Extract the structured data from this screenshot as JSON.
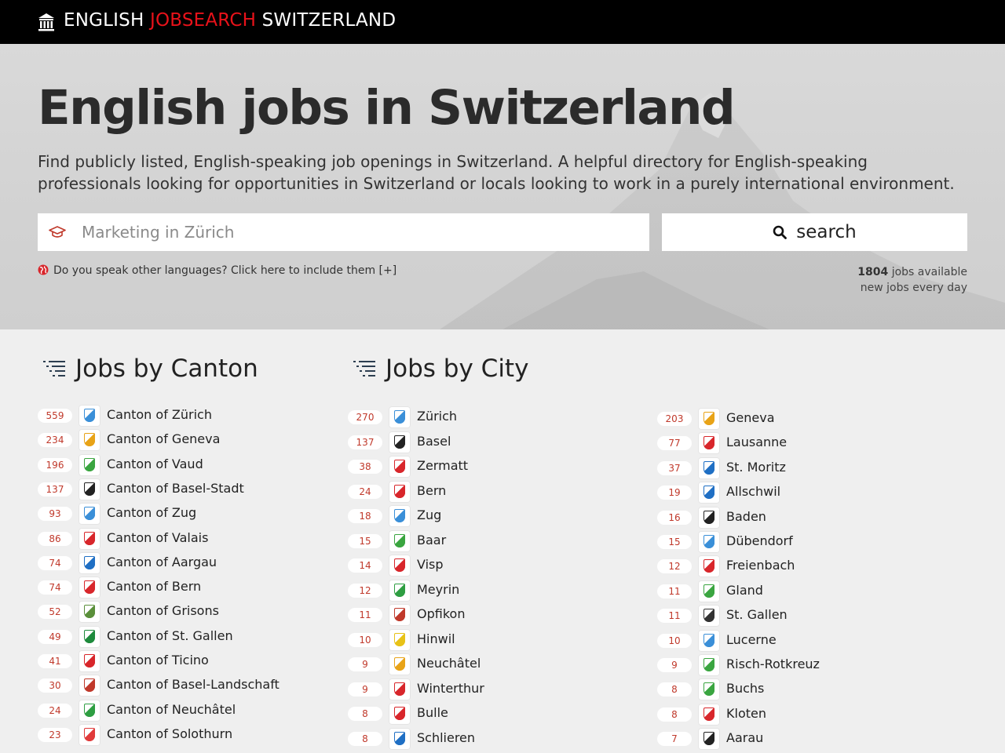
{
  "header": {
    "brand_part1": "ENGLISH",
    "brand_part2": "JOBSEARCH",
    "brand_part3": "SWITZERLAND",
    "logo_icon": "building-icon",
    "accent_color": "#e8121a"
  },
  "hero": {
    "title": "English jobs in Switzerland",
    "lead": "Find publicly listed, English-speaking job openings in Switzerland. A helpful directory for English-speaking professionals looking for opportunities in Switzerland or locals looking to work in a purely international environment.",
    "search_placeholder": "Marketing in Zürich",
    "search_icon": "graduation-cap-icon",
    "search_button": "search",
    "languages_link": "Do you speak other languages? Click here to include them [+]",
    "jobs_count": "1804",
    "jobs_available": "jobs available",
    "new_jobs": "new jobs every day"
  },
  "cantons": {
    "title": "Jobs by Canton",
    "items": [
      {
        "count": "559",
        "name": "Canton of Zürich",
        "color": "#3a8fd8"
      },
      {
        "count": "234",
        "name": "Canton of Geneva",
        "color": "#e8a317"
      },
      {
        "count": "196",
        "name": "Canton of Vaud",
        "color": "#3aa540"
      },
      {
        "count": "137",
        "name": "Canton of Basel-Stadt",
        "color": "#222222"
      },
      {
        "count": "93",
        "name": "Canton of Zug",
        "color": "#3a8fd8"
      },
      {
        "count": "86",
        "name": "Canton of Valais",
        "color": "#d8262b"
      },
      {
        "count": "74",
        "name": "Canton of Aargau",
        "color": "#1f6fc4"
      },
      {
        "count": "74",
        "name": "Canton of Bern",
        "color": "#d8262b"
      },
      {
        "count": "52",
        "name": "Canton of Grisons",
        "color": "#5a8f3a"
      },
      {
        "count": "49",
        "name": "Canton of St. Gallen",
        "color": "#1e8a3c"
      },
      {
        "count": "41",
        "name": "Canton of Ticino",
        "color": "#d8262b"
      },
      {
        "count": "30",
        "name": "Canton of Basel-Landschaft",
        "color": "#c0392b"
      },
      {
        "count": "24",
        "name": "Canton of Neuchâtel",
        "color": "#2e9e42"
      },
      {
        "count": "23",
        "name": "Canton of Solothurn",
        "color": "#e03a3a"
      }
    ]
  },
  "cities": {
    "title": "Jobs by City",
    "col1": [
      {
        "count": "270",
        "name": "Zürich",
        "color": "#3a8fd8"
      },
      {
        "count": "137",
        "name": "Basel",
        "color": "#222222"
      },
      {
        "count": "38",
        "name": "Zermatt",
        "color": "#d8262b"
      },
      {
        "count": "24",
        "name": "Bern",
        "color": "#d8262b"
      },
      {
        "count": "18",
        "name": "Zug",
        "color": "#3a8fd8"
      },
      {
        "count": "15",
        "name": "Baar",
        "color": "#3aa540"
      },
      {
        "count": "14",
        "name": "Visp",
        "color": "#d8262b"
      },
      {
        "count": "12",
        "name": "Meyrin",
        "color": "#2e9e42"
      },
      {
        "count": "11",
        "name": "Opfikon",
        "color": "#c0392b"
      },
      {
        "count": "10",
        "name": "Hinwil",
        "color": "#e8c217"
      },
      {
        "count": "9",
        "name": "Neuchâtel",
        "color": "#e8a317"
      },
      {
        "count": "9",
        "name": "Winterthur",
        "color": "#d8262b"
      },
      {
        "count": "8",
        "name": "Bulle",
        "color": "#d8262b"
      },
      {
        "count": "8",
        "name": "Schlieren",
        "color": "#1f6fc4"
      }
    ],
    "col2": [
      {
        "count": "203",
        "name": "Geneva",
        "color": "#e8a317"
      },
      {
        "count": "77",
        "name": "Lausanne",
        "color": "#d8262b"
      },
      {
        "count": "37",
        "name": "St. Moritz",
        "color": "#1f6fc4"
      },
      {
        "count": "19",
        "name": "Allschwil",
        "color": "#1f6fc4"
      },
      {
        "count": "16",
        "name": "Baden",
        "color": "#222222"
      },
      {
        "count": "15",
        "name": "Dübendorf",
        "color": "#3a8fd8"
      },
      {
        "count": "12",
        "name": "Freienbach",
        "color": "#d8262b"
      },
      {
        "count": "11",
        "name": "Gland",
        "color": "#3aa540"
      },
      {
        "count": "11",
        "name": "St. Gallen",
        "color": "#333333"
      },
      {
        "count": "10",
        "name": "Lucerne",
        "color": "#3a8fd8"
      },
      {
        "count": "9",
        "name": "Risch-Rotkreuz",
        "color": "#3aa540"
      },
      {
        "count": "8",
        "name": "Buchs",
        "color": "#3aa540"
      },
      {
        "count": "8",
        "name": "Kloten",
        "color": "#d8262b"
      },
      {
        "count": "7",
        "name": "Aarau",
        "color": "#222222"
      }
    ]
  }
}
